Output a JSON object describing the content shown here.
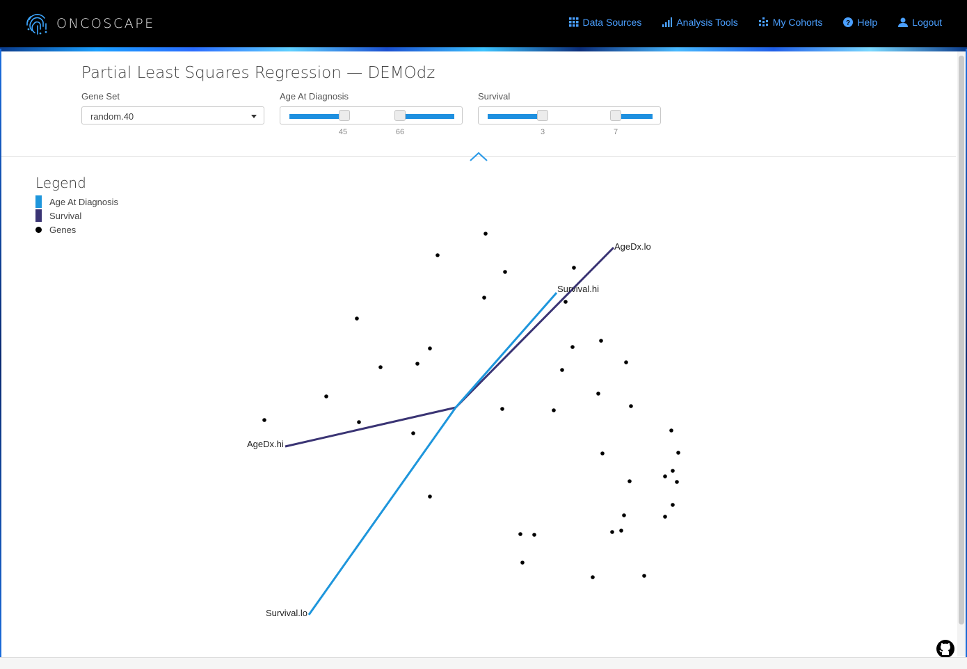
{
  "app": {
    "name": "ONCOSCAPE"
  },
  "nav": [
    {
      "label": "Data Sources",
      "icon": "grid-icon"
    },
    {
      "label": "Analysis Tools",
      "icon": "bar-chart-icon"
    },
    {
      "label": "My Cohorts",
      "icon": "cohort-icon"
    },
    {
      "label": "Help",
      "icon": "question-icon"
    },
    {
      "label": "Logout",
      "icon": "user-icon"
    }
  ],
  "page": {
    "title": "Partial Least Squares Regression — DEMOdz"
  },
  "controls": {
    "gene_set": {
      "label": "Gene Set",
      "value": "random.40"
    },
    "age": {
      "label": "Age At Diagnosis",
      "low": "45",
      "high": "66"
    },
    "survival": {
      "label": "Survival",
      "low": "3",
      "high": "7"
    }
  },
  "legend": {
    "title": "Legend",
    "items": [
      {
        "label": "Age At Diagnosis",
        "color": "#1e96dc"
      },
      {
        "label": "Survival",
        "color": "#3a3474"
      },
      {
        "label": "Genes",
        "color": "#000000"
      }
    ]
  },
  "chart_data": {
    "type": "scatter",
    "vectors": [
      {
        "series": "Survival",
        "color": "#3a3474",
        "from": "AgeDx.hi",
        "to": "AgeDx.lo"
      },
      {
        "series": "Age At Diagnosis",
        "color": "#1e96dc",
        "from": "Survival.lo",
        "to": "Survival.hi"
      }
    ],
    "labels": [
      "AgeDx.lo",
      "Survival.hi",
      "AgeDx.hi",
      "Survival.lo"
    ],
    "genes_count": 43
  }
}
